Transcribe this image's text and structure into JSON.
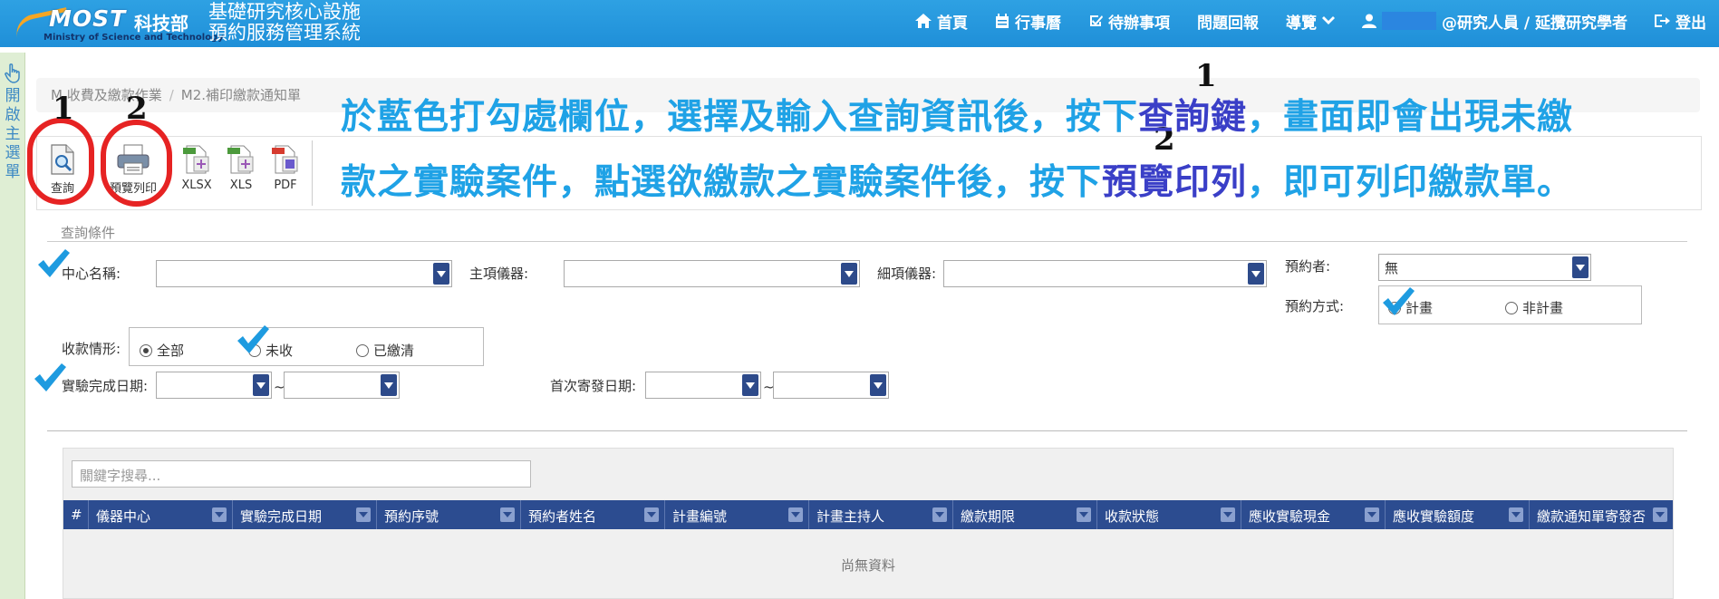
{
  "navbar": {
    "logo_text": "MOST",
    "logo_cn": "科技部",
    "logo_en": "Ministry of Science and Technology",
    "title_line1": "基礎研究核心設施",
    "title_line2": "預約服務管理系統",
    "items": [
      {
        "label": "首頁",
        "icon": "home-icon"
      },
      {
        "label": "行事曆",
        "icon": "calendar-icon"
      },
      {
        "label": "待辦事項",
        "icon": "check-square-icon"
      },
      {
        "label": "問題回報",
        "icon": ""
      },
      {
        "label": "導覽",
        "icon": "chevron-down-icon"
      },
      {
        "label": "@研究人員 / 延攬研究學者",
        "icon": "user-icon"
      },
      {
        "label": "登出",
        "icon": "logout-icon"
      }
    ]
  },
  "side_menu": {
    "label": "開啟主選單"
  },
  "breadcrumb": {
    "level1": "M.收費及繳款作業",
    "separator": "/",
    "level2": "M2.補印繳款通知單"
  },
  "toolbar": {
    "query_label": "查詢",
    "preview_label": "預覽列印",
    "xlsx_label": "XLSX",
    "xls_label": "XLS",
    "pdf_label": "PDF"
  },
  "annotations": {
    "num1": "1",
    "num2": "2",
    "line1_pre": "於藍色打勾處欄位，選擇及輸入查詢資訊後，按下",
    "line1_hl": "查詢鍵",
    "line1_post": "，畫面即會出現未繳",
    "line2_pre": "款之實驗案件，點選欲繳款之實驗案件後，按下",
    "line2_hl": "預覽印列",
    "line2_post": "，即可列印繳款單。"
  },
  "query": {
    "section_title": "查詢條件",
    "center_label": "中心名稱:",
    "main_instrument_label": "主項儀器:",
    "sub_instrument_label": "細項儀器:",
    "booker_label": "預約者:",
    "booker_value": "無",
    "booking_method_label": "預約方式:",
    "booking_method_options": [
      "計畫",
      "非計畫"
    ],
    "payment_status_label": "收款情形:",
    "payment_status_options": [
      "全部",
      "未收",
      "已繳清"
    ],
    "completion_date_label": "實驗完成日期:",
    "first_send_date_label": "首次寄發日期:",
    "range_sep": "~"
  },
  "grid": {
    "search_placeholder": "關鍵字搜尋...",
    "columns": [
      "#",
      "儀器中心",
      "實驗完成日期",
      "預約序號",
      "預約者姓名",
      "計畫編號",
      "計畫主持人",
      "繳款期限",
      "收款狀態",
      "應收實驗現金",
      "應收實驗額度",
      "繳款通知單寄發否"
    ],
    "empty_text": "尚無資料"
  },
  "colors": {
    "navbar": "#1f8fd8",
    "grid_header": "#2c4c90",
    "annotation": "#1fa2e6",
    "highlight": "#3a3fc7",
    "circle": "#e62323",
    "checkmark": "#1e9be0"
  }
}
